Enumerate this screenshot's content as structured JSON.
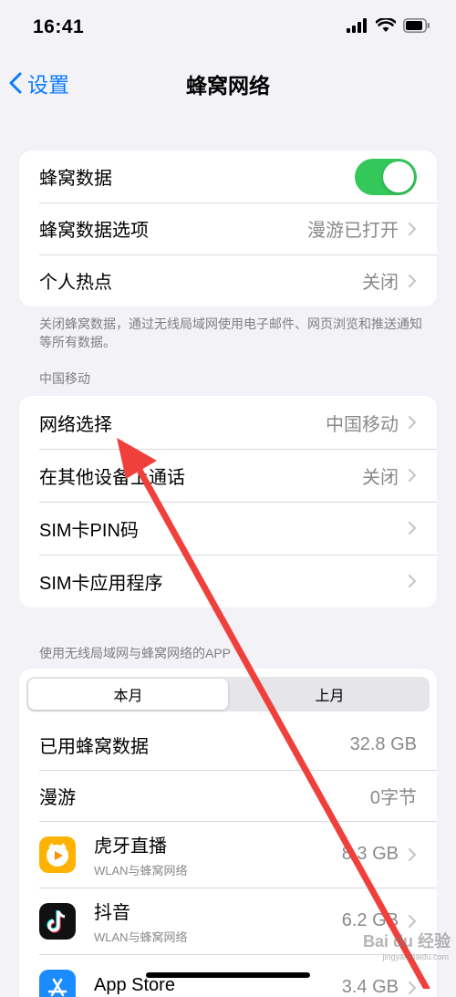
{
  "status_bar": {
    "time": "16:41"
  },
  "nav": {
    "back_label": "设置",
    "title": "蜂窝网络"
  },
  "group1": {
    "rows": [
      {
        "label": "蜂窝数据",
        "toggle_on": true
      },
      {
        "label": "蜂窝数据选项",
        "value": "漫游已打开"
      },
      {
        "label": "个人热点",
        "value": "关闭"
      }
    ],
    "footer": "关闭蜂窝数据，通过无线局域网使用电子邮件、网页浏览和推送通知等所有数据。"
  },
  "group2": {
    "header": "中国移动",
    "rows": [
      {
        "label": "网络选择",
        "value": "中国移动"
      },
      {
        "label": "在其他设备上通话",
        "value": "关闭"
      },
      {
        "label": "SIM卡PIN码",
        "value": ""
      },
      {
        "label": "SIM卡应用程序",
        "value": ""
      }
    ]
  },
  "group3": {
    "header": "使用无线局域网与蜂窝网络的APP",
    "segments": [
      "本月",
      "上月"
    ],
    "selected_segment": "本月",
    "stats": [
      {
        "label": "已用蜂窝数据",
        "value": "32.8 GB"
      },
      {
        "label": "漫游",
        "value": "0字节"
      }
    ],
    "apps": [
      {
        "name": "虎牙直播",
        "sub": "WLAN与蜂窝网络",
        "value": "8.3 GB",
        "icon": "huya-icon"
      },
      {
        "name": "抖音",
        "sub": "WLAN与蜂窝网络",
        "value": "6.2 GB",
        "icon": "douyin-icon"
      },
      {
        "name": "App Store",
        "sub": "",
        "value": "3.4 GB",
        "icon": "app-store-icon"
      }
    ]
  },
  "watermark": {
    "text": "Bai du 经验",
    "sub": "jingyan.baidu.com"
  },
  "colors": {
    "accent": "#0a7aff",
    "toggle": "#34c759",
    "arrow": "#f0403c"
  }
}
